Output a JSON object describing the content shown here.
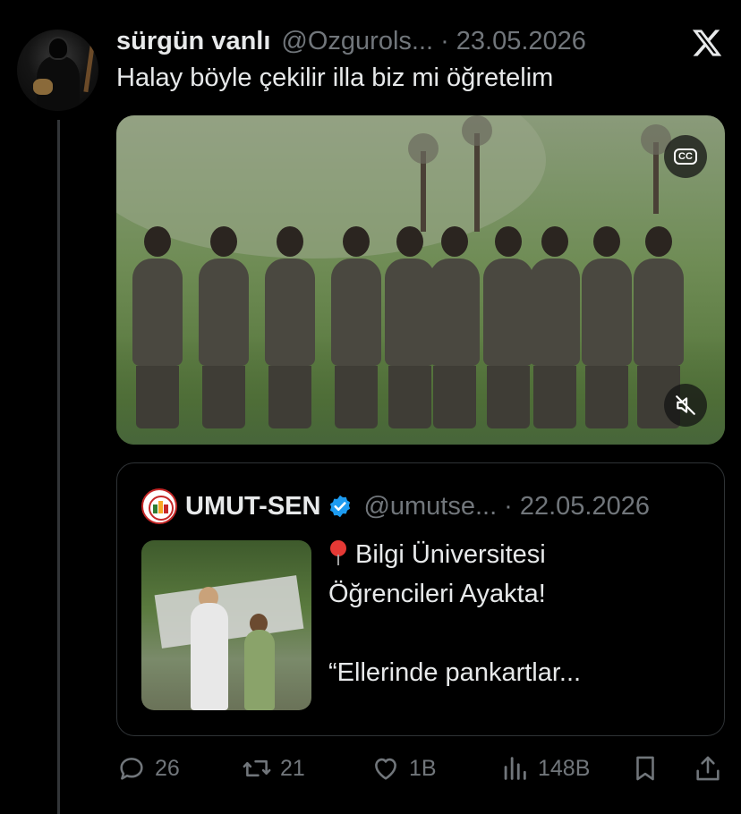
{
  "tweet": {
    "display_name": "sürgün vanlı",
    "handle": "@Ozgurols...",
    "separator": "·",
    "date": "23.05.2026",
    "text": "Halay böyle çekilir illa biz mi öğretelim"
  },
  "quoted_tweet": {
    "display_name": "UMUT-SEN",
    "handle": "@umutse...",
    "separator": "·",
    "date": "22.05.2026",
    "text_lines": [
      "Bilgi Üniversitesi",
      "Öğrencileri Ayakta!",
      "",
      "“Ellerinde pankartlar..."
    ]
  },
  "actions": {
    "replies": "26",
    "reposts": "21",
    "likes": "1B",
    "views": "148B"
  },
  "icons": {
    "brand": "x-logo-icon",
    "closed_captions": "cc-icon",
    "muted": "speaker-muted-icon",
    "verified": "verified-badge-icon",
    "reply": "reply-icon",
    "repost": "repost-icon",
    "like": "heart-icon",
    "views": "views-icon",
    "bookmark": "bookmark-icon",
    "share": "share-icon"
  },
  "colors": {
    "background": "#000000",
    "text_primary": "#e7e9ea",
    "text_secondary": "#71767b",
    "border": "#2f3336",
    "verified": "#1d9bf0"
  }
}
